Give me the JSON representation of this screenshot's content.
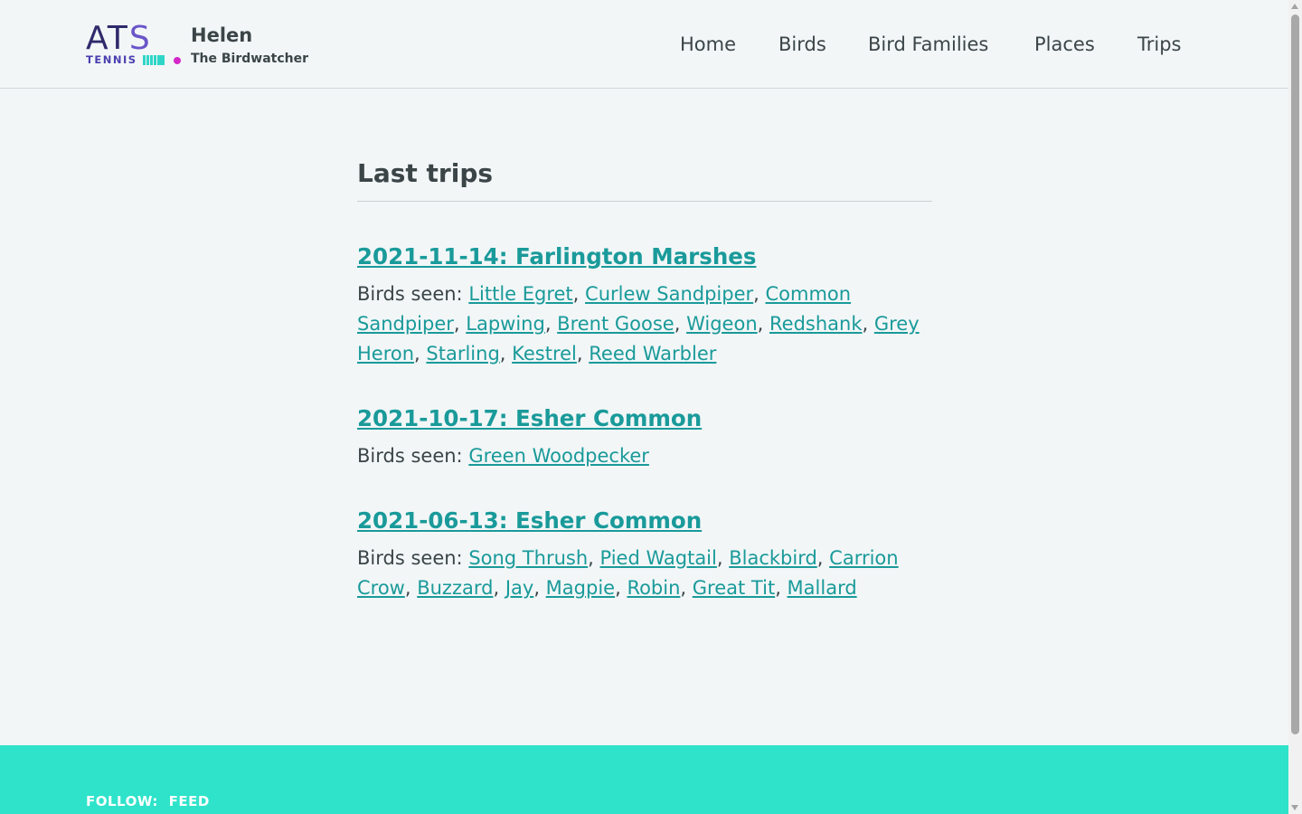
{
  "header": {
    "logo": {
      "wordmark": "ATS",
      "subtext": "TENNIS"
    },
    "site_name": "Helen",
    "tagline": "The Birdwatcher",
    "nav": [
      "Home",
      "Birds",
      "Bird Families",
      "Places",
      "Trips"
    ]
  },
  "main": {
    "title": "Last trips",
    "birds_seen_label": "Birds seen:",
    "trips": [
      {
        "title": "2021-11-14: Farlington Marshes",
        "birds": [
          "Little Egret",
          "Curlew Sandpiper",
          "Common Sandpiper",
          "Lapwing",
          "Brent Goose",
          "Wigeon",
          "Redshank",
          "Grey Heron",
          "Starling",
          "Kestrel",
          "Reed Warbler"
        ]
      },
      {
        "title": "2021-10-17: Esher Common",
        "birds": [
          "Green Woodpecker"
        ]
      },
      {
        "title": "2021-06-13: Esher Common",
        "birds": [
          "Song Thrush",
          "Pied Wagtail",
          "Blackbird",
          "Carrion Crow",
          "Buzzard",
          "Jay",
          "Magpie",
          "Robin",
          "Great Tit",
          "Mallard"
        ]
      }
    ]
  },
  "footer": {
    "follow_label": "FOLLOW:",
    "links": [
      "FEED"
    ]
  },
  "colors": {
    "accent": "#1a9a9a",
    "footer_bg": "#2ee3ca",
    "text": "#3b4548",
    "page_bg": "#f2f6f7"
  }
}
